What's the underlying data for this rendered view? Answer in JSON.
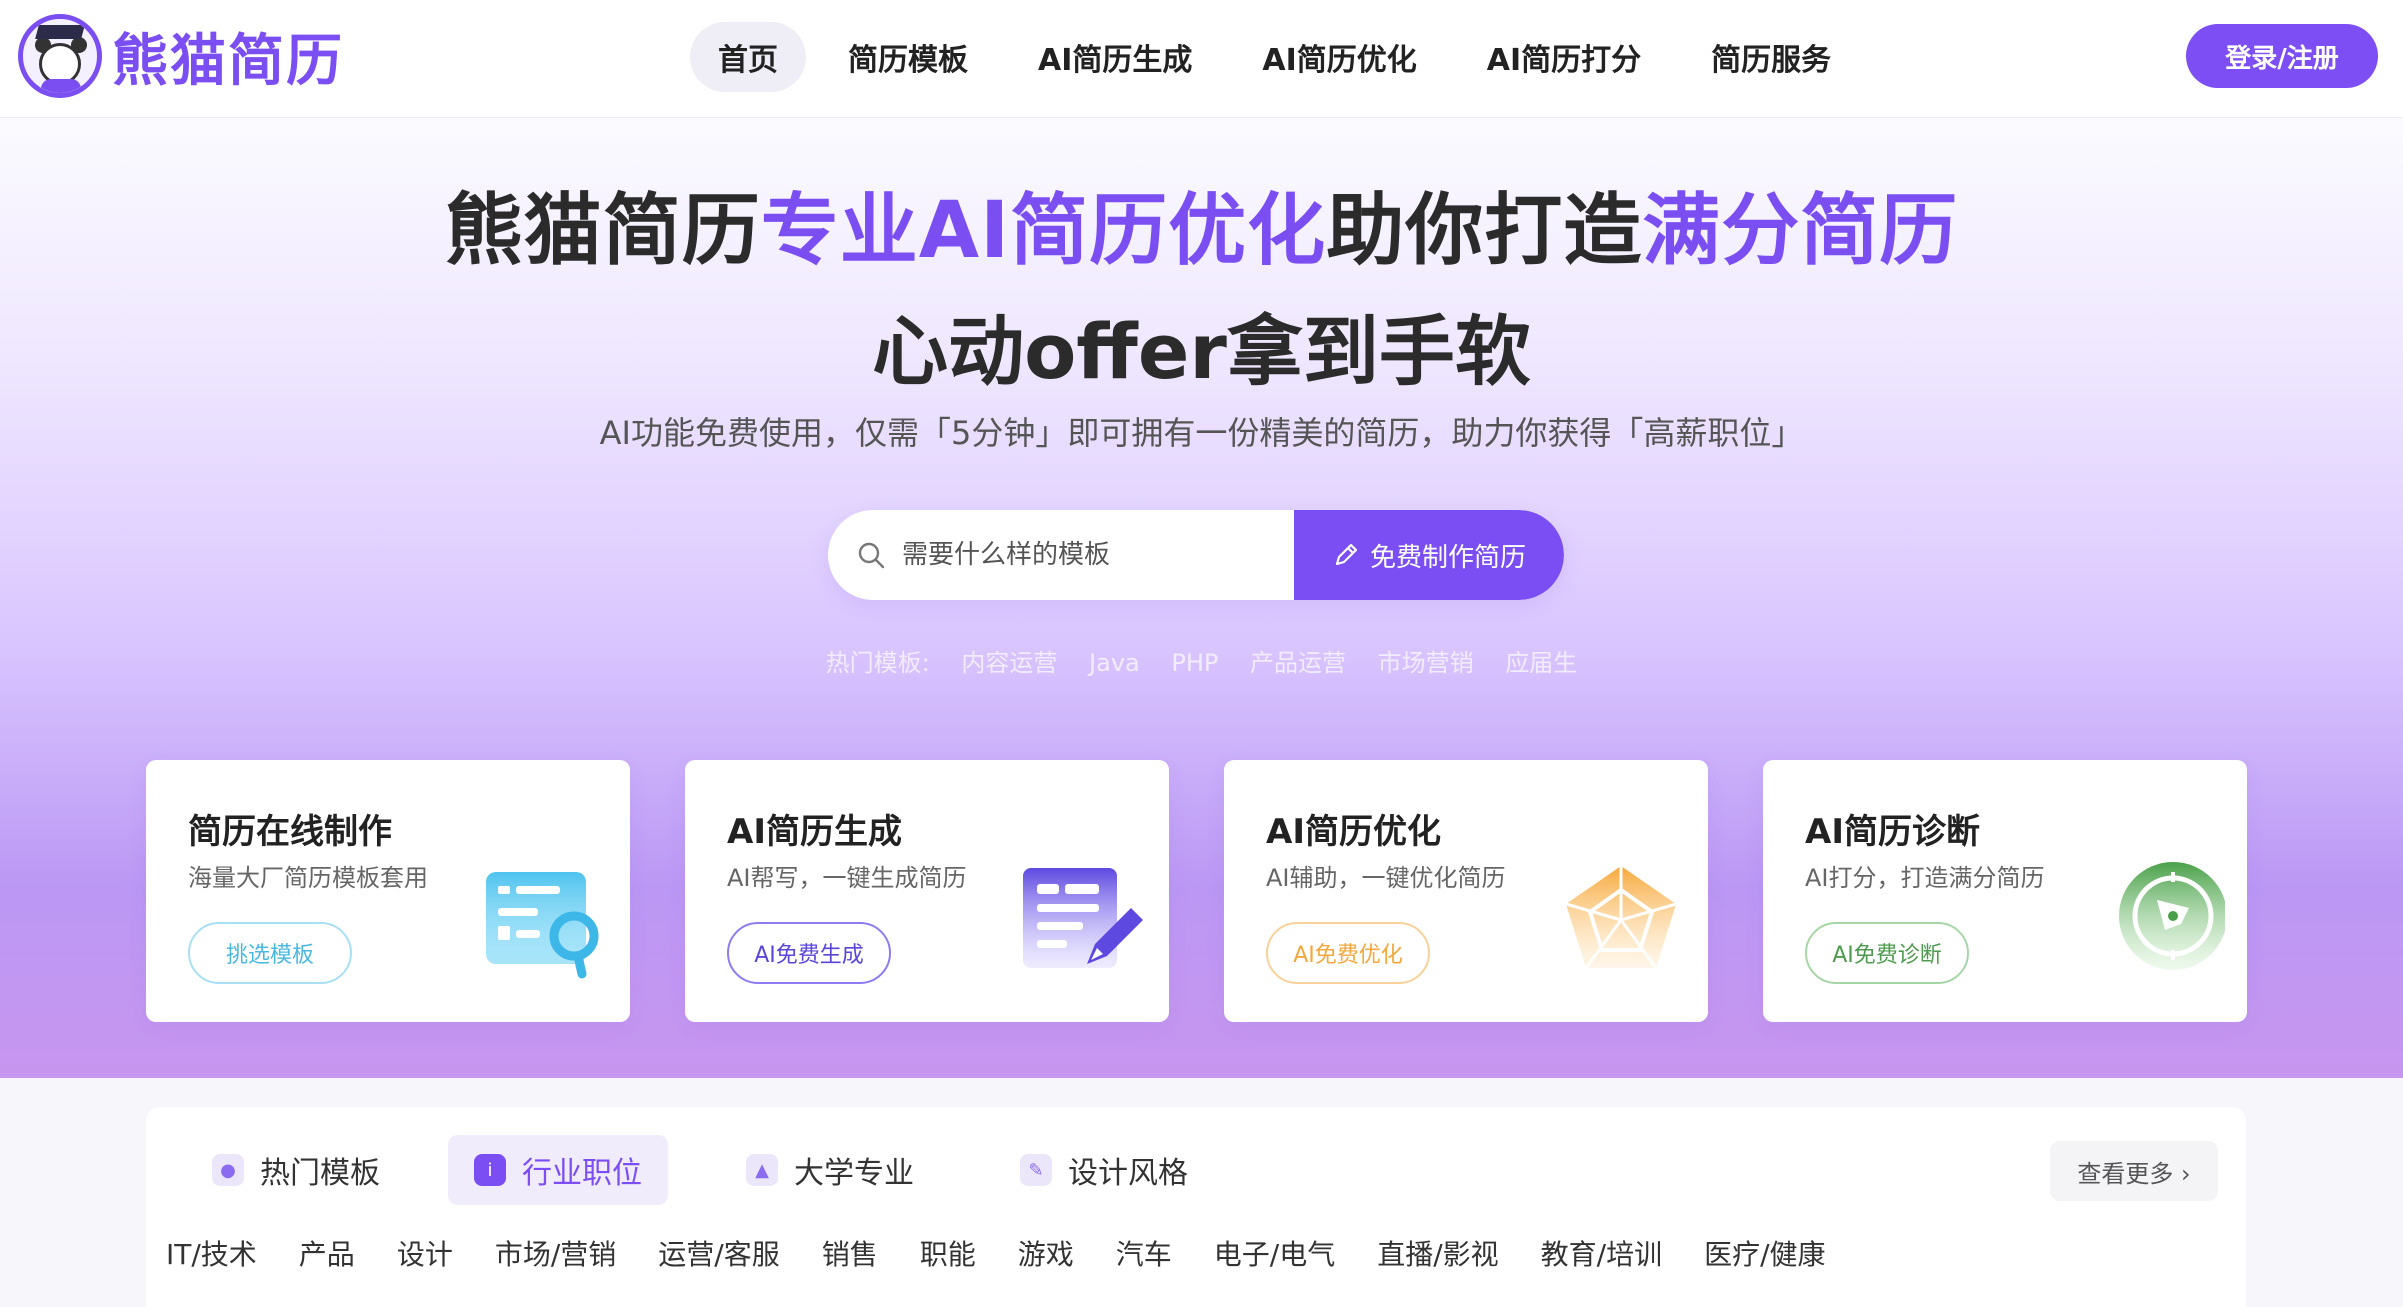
{
  "header": {
    "logo_text": "熊猫简历",
    "nav": [
      {
        "label": "首页",
        "active": true
      },
      {
        "label": "简历模板"
      },
      {
        "label": "AI简历生成"
      },
      {
        "label": "AI简历优化"
      },
      {
        "label": "AI简历打分"
      },
      {
        "label": "简历服务"
      }
    ],
    "login_label": "登录/注册"
  },
  "hero": {
    "title_part1": "熊猫简历",
    "title_accent1": "专业AI简历优化",
    "title_part2": "助你打造",
    "title_accent2": "满分简历",
    "subtitle": "心动offer拿到手软",
    "description": "AI功能免费使用，仅需「5分钟」即可拥有一份精美的简历，助力你获得「高薪职位」",
    "search_placeholder": "需要什么样的模板",
    "make_button": "免费制作简历",
    "hot_label": "热门模板:",
    "hot_tags": [
      "内容运营",
      "Java",
      "PHP",
      "产品运营",
      "市场营销",
      "应届生"
    ]
  },
  "cards": [
    {
      "title": "简历在线制作",
      "desc": "海量大厂简历模板套用",
      "button": "挑选模板",
      "color": "#5bc4e8",
      "icon": "resume-search-icon"
    },
    {
      "title": "AI简历生成",
      "desc": "AI帮写，一键生成简历",
      "button": "AI免费生成",
      "color": "#6a50e6",
      "icon": "document-pen-icon"
    },
    {
      "title": "AI简历优化",
      "desc": "AI辅助，一键优化简历",
      "button": "AI免费优化",
      "color": "#f6b24a",
      "icon": "pentagon-radar-icon"
    },
    {
      "title": "AI简历诊断",
      "desc": "AI打分，打造满分简历",
      "button": "AI免费诊断",
      "color": "#5aa85c",
      "icon": "compass-icon"
    }
  ],
  "panel": {
    "tabs": [
      {
        "label": "热门模板",
        "icon": "fire-icon"
      },
      {
        "label": "行业职位",
        "icon": "info-icon",
        "active": true
      },
      {
        "label": "大学专业",
        "icon": "graduation-icon"
      },
      {
        "label": "设计风格",
        "icon": "brush-icon"
      }
    ],
    "more_label": "查看更多 ›",
    "categories": [
      "IT/技术",
      "产品",
      "设计",
      "市场/营销",
      "运营/客服",
      "销售",
      "职能",
      "游戏",
      "汽车",
      "电子/电气",
      "直播/影视",
      "教育/培训",
      "医疗/健康"
    ]
  }
}
